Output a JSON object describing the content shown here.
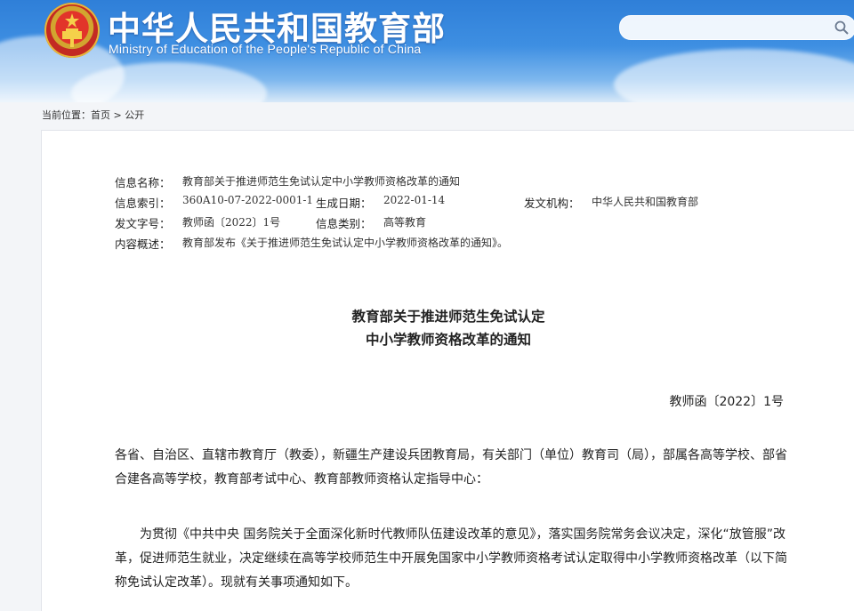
{
  "header": {
    "site_title": "中华人民共和国教育部",
    "site_subtitle": "Ministry of Education of the People's Republic of China",
    "search": {
      "placeholder": "",
      "value": ""
    }
  },
  "breadcrumb": {
    "prefix": "当前位置：",
    "items": [
      "首页",
      "公开"
    ],
    "separator": " > "
  },
  "meta": {
    "name_label": "信息名称：",
    "name_value": "教育部关于推进师范生免试认定中小学教师资格改革的通知",
    "index_label": "信息索引：",
    "index_value": "360A10-07-2022-0001-1",
    "date_label": "生成日期：",
    "date_value": "2022-01-14",
    "issuer_label": "发文机构：",
    "issuer_value": "中华人民共和国教育部",
    "docno_label": "发文字号：",
    "docno_value": "教师函〔2022〕1号",
    "category_label": "信息类别：",
    "category_value": "高等教育",
    "summary_label": "内容概述：",
    "summary_value": "教育部发布《关于推进师范生免试认定中小学教师资格改革的通知》。"
  },
  "document": {
    "title_line1": "教育部关于推进师范生免试认定",
    "title_line2": "中小学教师资格改革的通知",
    "number": "教师函〔2022〕1号",
    "addressee": "各省、自治区、直辖市教育厅（教委），新疆生产建设兵团教育局，有关部门（单位）教育司（局），部属各高等学校、部省合建各高等学校，教育部考试中心、教育部教师资格认定指导中心：",
    "body": "为贯彻《中共中央 国务院关于全面深化新时代教师队伍建设改革的意见》，落实国务院常务会议决定，深化“放管服”改革，促进师范生就业，决定继续在高等学校师范生中开展免国家中小学教师资格考试认定取得中小学教师资格改革（以下简称免试认定改革）。现就有关事项通知如下。"
  },
  "colors": {
    "header_blue": "#2f7fd8",
    "emblem_red": "#c32a23",
    "emblem_gold": "#e6b83a"
  },
  "icons": [
    "national-emblem-icon",
    "search-icon"
  ]
}
